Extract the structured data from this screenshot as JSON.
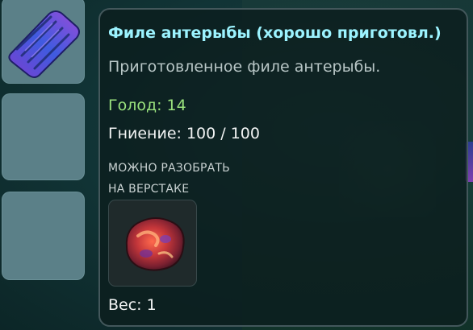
{
  "tooltip": {
    "title": "Филе антерыбы (хорошо приготовл.)",
    "description": "Приготовленное филе антерыбы.",
    "hunger": "Голод: 14",
    "decay": "Гниение: 100 / 100",
    "salvage_line1": "МОЖНО РАЗОБРАТЬ",
    "salvage_line2": "НА ВЕРСТАКЕ",
    "weight": "Вес: 1",
    "salvage_item_icon": "raw-meat-chunk-icon"
  },
  "inventory": {
    "slots": [
      {
        "icon": "antfish-fillet-icon",
        "filled": true
      },
      {
        "filled": false
      },
      {
        "filled": false
      }
    ]
  },
  "colors": {
    "title": "#9cf3ff",
    "hunger": "#9be37e",
    "description": "#b8c6c6",
    "text": "#f2f4f4"
  }
}
